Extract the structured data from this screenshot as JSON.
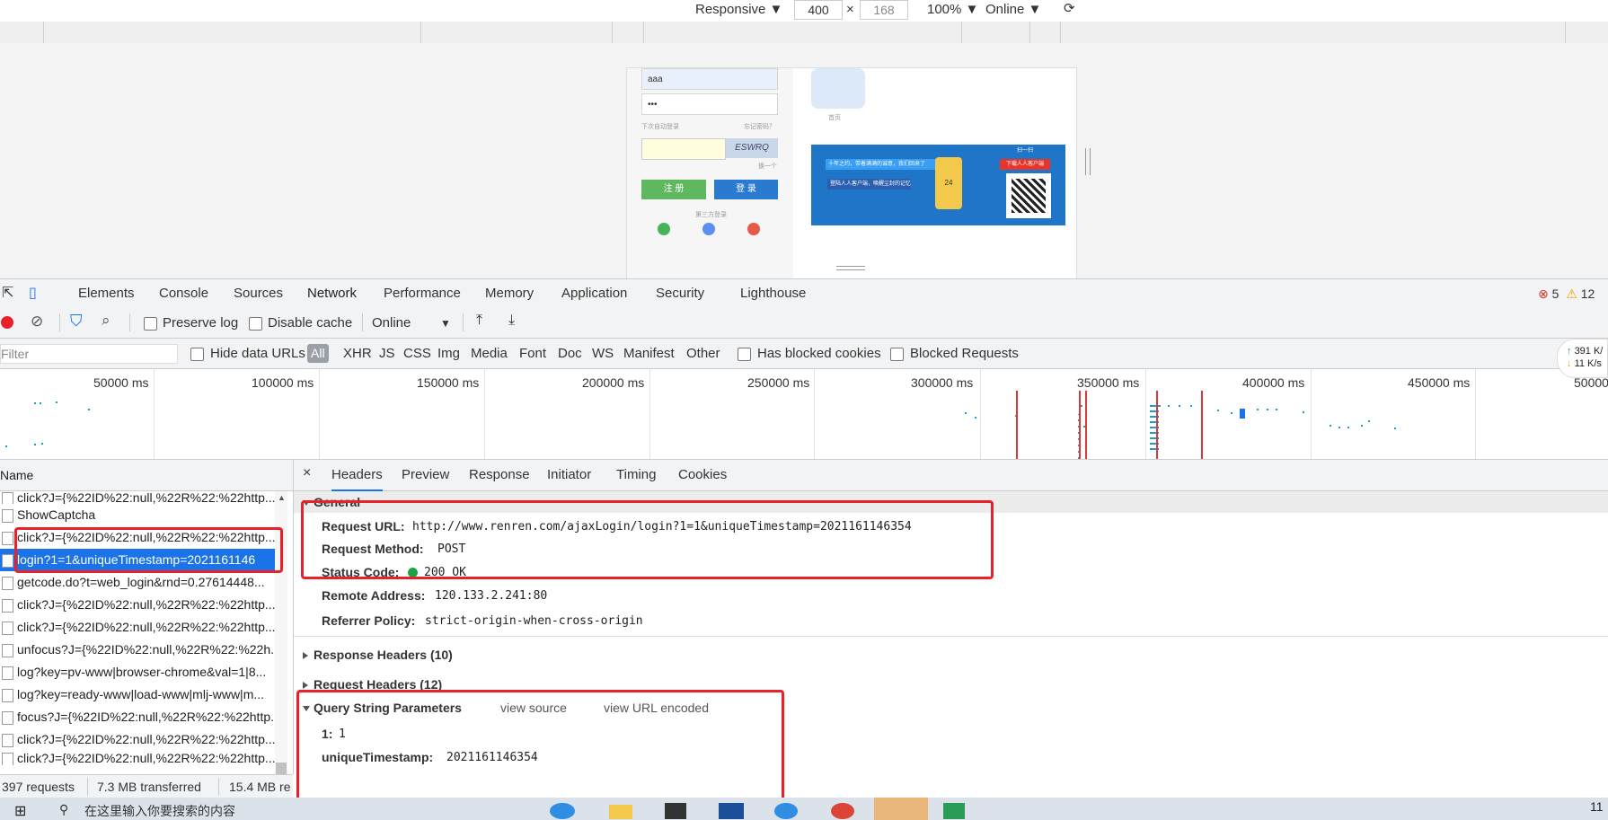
{
  "device_bar": {
    "mode": "Responsive ▼",
    "width": "400",
    "times": "×",
    "height": "168",
    "zoom": "100% ▼",
    "throttle": "Online ▼"
  },
  "page_preview": {
    "username": "aaa",
    "password": "•••",
    "remember_text": "下次自动登录",
    "forgot_text": "忘记密码？",
    "captcha_text": "ESWRQ",
    "refresh_text": "换一个",
    "register_label": "注 册",
    "login_label": "登 录",
    "third_party_text": "第三方登录",
    "app_label": "首页",
    "banner_line1": "十年之约，带着满满的诚意，我们回来了",
    "banner_line2": "登陆人人客户端，唤醒尘封的记忆",
    "banner_cta": "下载人人客户端",
    "banner_tag": "扫一扫",
    "jersey_number": "24"
  },
  "devtools": {
    "tabs": [
      "Elements",
      "Console",
      "Sources",
      "Network",
      "Performance",
      "Memory",
      "Application",
      "Security",
      "Lighthouse"
    ],
    "active_tab": "Network",
    "errors": "5",
    "warnings": "12",
    "toolbar": {
      "preserve_log": "Preserve log",
      "disable_cache": "Disable cache",
      "throttle": "Online"
    },
    "filter": {
      "placeholder": "Filter",
      "hide_data_urls": "Hide data URLs",
      "types": [
        "All",
        "XHR",
        "JS",
        "CSS",
        "Img",
        "Media",
        "Font",
        "Doc",
        "WS",
        "Manifest",
        "Other"
      ],
      "has_blocked_cookies": "Has blocked cookies",
      "blocked_requests": "Blocked Requests"
    },
    "speed": {
      "up": "391 K/",
      "down": "11 K/s"
    },
    "overview_labels": [
      "50000 ms",
      "100000 ms",
      "150000 ms",
      "200000 ms",
      "250000 ms",
      "300000 ms",
      "350000 ms",
      "400000 ms",
      "450000 ms",
      "50000"
    ],
    "request_list": {
      "header": "Name",
      "rows": [
        "click?J={%22ID%22:null,%22R%22:%22http...",
        "ShowCaptcha",
        "click?J={%22ID%22:null,%22R%22:%22http...",
        "login?1=1&uniqueTimestamp=2021161146",
        "getcode.do?t=web_login&rnd=0.27614448...",
        "click?J={%22ID%22:null,%22R%22:%22http...",
        "click?J={%22ID%22:null,%22R%22:%22http...",
        "unfocus?J={%22ID%22:null,%22R%22:%22h...",
        "log?key=pv-www|browser-chrome&val=1|8...",
        "log?key=ready-www|load-www|mlj-www|m...",
        "focus?J={%22ID%22:null,%22R%22:%22http...",
        "click?J={%22ID%22:null,%22R%22:%22http...",
        "click?J={%22ID%22:null,%22R%22:%22http..."
      ],
      "selected_index": 3
    },
    "detail_tabs": [
      "Headers",
      "Preview",
      "Response",
      "Initiator",
      "Timing",
      "Cookies"
    ],
    "active_detail_tab": "Headers",
    "general": {
      "title": "General",
      "request_url_key": "Request URL:",
      "request_url": "http://www.renren.com/ajaxLogin/login?1=1&uniqueTimestamp=2021161146354",
      "request_method_key": "Request Method:",
      "request_method": "POST",
      "status_code_key": "Status Code:",
      "status_code": "200 OK",
      "remote_address_key": "Remote Address:",
      "remote_address": "120.133.2.241:80",
      "referrer_policy_key": "Referrer Policy:",
      "referrer_policy": "strict-origin-when-cross-origin"
    },
    "response_headers": "Response Headers (10)",
    "request_headers": "Request Headers (12)",
    "query_params": {
      "title": "Query String Parameters",
      "view_source": "view source",
      "view_url_encoded": "view URL encoded",
      "params": [
        {
          "key": "1:",
          "value": "1"
        },
        {
          "key": "uniqueTimestamp:",
          "value": "2021161146354"
        }
      ]
    },
    "status_bar": {
      "requests": "397 requests",
      "transferred": "7.3 MB transferred",
      "resources": "15.4 MB re"
    }
  },
  "taskbar": {
    "search_text": "在这里输入你要搜索的内容",
    "clock": "11"
  },
  "colors": {
    "accent": "#1a73e8",
    "highlight_box": "#e8222a",
    "status_ok": "#1ea446"
  }
}
